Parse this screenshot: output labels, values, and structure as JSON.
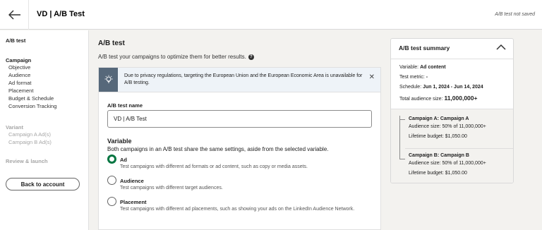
{
  "header": {
    "title": "VD | A/B Test",
    "status": "A/B test not saved"
  },
  "sidebar": {
    "ab_test": "A/B test",
    "campaign_head": "Campaign",
    "campaign_items": [
      "Objective",
      "Audience",
      "Ad format",
      "Placement",
      "Budget & Schedule",
      "Conversion Tracking"
    ],
    "variant_head": "Variant",
    "variant_items": [
      "Campaign A Ad(s)",
      "Campaign B Ad(s)"
    ],
    "review": "Review & launch",
    "back_button": "Back to account"
  },
  "main": {
    "title": "A/B test",
    "description": "A/B test your campaigns to optimize them for better results.",
    "notice": "Due to privacy regulations, targeting the European Union and the European Economic Area is unavailable for A/B testing.",
    "name_label": "A/B test name",
    "name_value": "VD | A/B Test",
    "variable_title": "Variable",
    "variable_desc": "Both campaigns in an A/B test share the same settings, aside from the selected variable.",
    "options": [
      {
        "label": "Ad",
        "desc": "Test campaigns with different ad formats or ad content, such as copy or media assets.",
        "selected": true
      },
      {
        "label": "Audience",
        "desc": "Test campaigns with different target audiences.",
        "selected": false
      },
      {
        "label": "Placement",
        "desc": "Test campaigns with different ad placements, such as showing your ads on the LinkedIn Audience Network.",
        "selected": false
      }
    ]
  },
  "summary": {
    "title": "A/B test summary",
    "variable_label": "Variable:",
    "variable_value": "Ad content",
    "metric_label": "Test metric:",
    "metric_value": "-",
    "schedule_label": "Schedule:",
    "schedule_value": "Jun 1, 2024 - Jun 14, 2024",
    "audience_label": "Total audience size:",
    "audience_value": "11,000,000+",
    "campaign_a": {
      "name": "Campaign A: Campaign A",
      "audience_label": "Audience size:",
      "audience_value": "50% of 11,000,000+",
      "budget_label": "Lifetime budget:",
      "budget_value": "$1,050.00"
    },
    "campaign_b": {
      "name": "Campaign B: Campaign B",
      "audience_label": "Audience size:",
      "audience_value": "50% of 11,000,000+",
      "budget_label": "Lifetime budget:",
      "budget_value": "$1,050.00"
    }
  },
  "colors": {
    "accent_green": "#057642",
    "notice_icon_bg": "#56687a",
    "notice_bg": "#eef3f8"
  }
}
